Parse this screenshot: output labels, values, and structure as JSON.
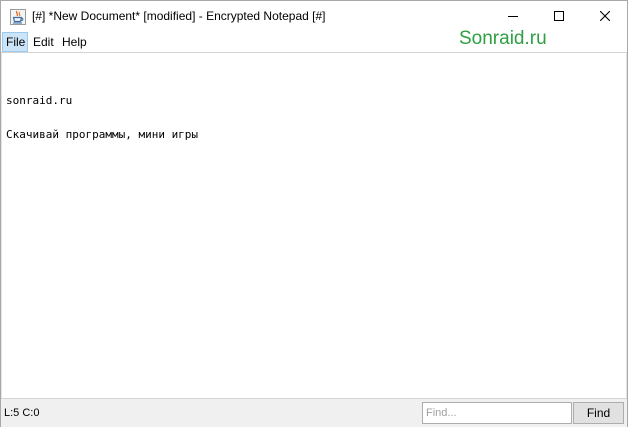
{
  "window": {
    "title": "[#] *New Document* [modified] - Encrypted Notepad [#]",
    "app_icon": "java-cup-icon",
    "controls": {
      "minimize_icon": "minimize-icon",
      "maximize_icon": "maximize-icon",
      "close_icon": "close-icon"
    }
  },
  "menubar": {
    "items": [
      {
        "label": "File",
        "selected": true
      },
      {
        "label": "Edit",
        "selected": false
      },
      {
        "label": "Help",
        "selected": false
      }
    ]
  },
  "watermark": "Sonraid.ru",
  "editor": {
    "lines": [
      "sonraid.ru",
      "Скачивай программы, мини игры"
    ]
  },
  "statusbar": {
    "cursor": "L:5 C:0",
    "find_placeholder": "Find...",
    "find_value": "",
    "find_button": "Find"
  },
  "colors": {
    "menu_selected_bg": "#cce4f7",
    "watermark": "#2ea043",
    "statusbar_bg": "#f0f0f0"
  }
}
